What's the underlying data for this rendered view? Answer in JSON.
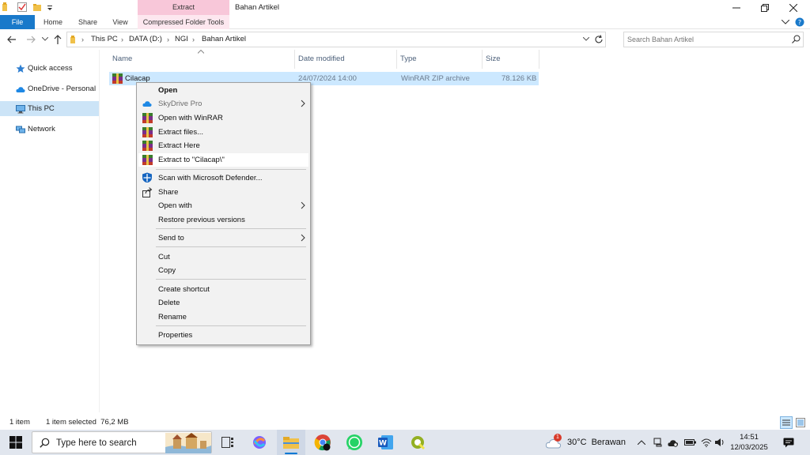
{
  "window": {
    "title": "Bahan Artikel",
    "context_tab_group": "Extract"
  },
  "ribbon": {
    "tabs": [
      "File",
      "Home",
      "Share",
      "View",
      "Compressed Folder Tools"
    ]
  },
  "address": {
    "breadcrumb": [
      "This PC",
      "DATA (D:)",
      "NGI",
      "Bahan Artikel"
    ],
    "search_placeholder": "Search Bahan Artikel"
  },
  "nav_pane": {
    "items": [
      {
        "label": "Quick access",
        "icon": "star-icon"
      },
      {
        "label": "OneDrive - Personal",
        "icon": "cloud-icon"
      },
      {
        "label": "This PC",
        "icon": "computer-icon",
        "selected": true
      },
      {
        "label": "Network",
        "icon": "network-icon"
      }
    ]
  },
  "file_list": {
    "columns": [
      "Name",
      "Date modified",
      "Type",
      "Size"
    ],
    "rows": [
      {
        "name": "Cilacap",
        "date": "24/07/2024 14:00",
        "type": "WinRAR ZIP archive",
        "size": "78.126 KB",
        "selected": true
      }
    ]
  },
  "context_menu": {
    "items": [
      {
        "label": "Open",
        "bold": true
      },
      {
        "label": "SkyDrive Pro",
        "icon": "skydrive-icon",
        "submenu": true,
        "disabled": true
      },
      {
        "label": "Open with WinRAR",
        "icon": "winrar-icon"
      },
      {
        "label": "Extract files...",
        "icon": "winrar-icon"
      },
      {
        "label": "Extract Here",
        "icon": "winrar-icon"
      },
      {
        "label": "Extract to \"Cilacap\\\"",
        "icon": "winrar-icon",
        "highlighted": true
      },
      {
        "label": "Scan with Microsoft Defender...",
        "icon": "defender-icon"
      },
      {
        "label": "Share",
        "icon": "share-icon"
      },
      {
        "label": "Open with",
        "submenu": true
      },
      {
        "label": "Restore previous versions"
      },
      {
        "label": "Send to",
        "submenu": true
      },
      {
        "label": "Cut"
      },
      {
        "label": "Copy"
      },
      {
        "label": "Create shortcut"
      },
      {
        "label": "Delete"
      },
      {
        "label": "Rename"
      },
      {
        "label": "Properties"
      }
    ]
  },
  "status_bar": {
    "item_count": "1 item",
    "selection": "1 item selected  76,2 MB"
  },
  "taskbar": {
    "search_placeholder": "Type here to search",
    "weather_temp": "30°C",
    "weather_text": "Berawan",
    "weather_badge": "1",
    "time": "14:51",
    "date": "12/03/2025"
  },
  "colors": {
    "accent": "#1979ca",
    "selection": "#cce8ff",
    "context_tab": "#f8c7d9"
  }
}
